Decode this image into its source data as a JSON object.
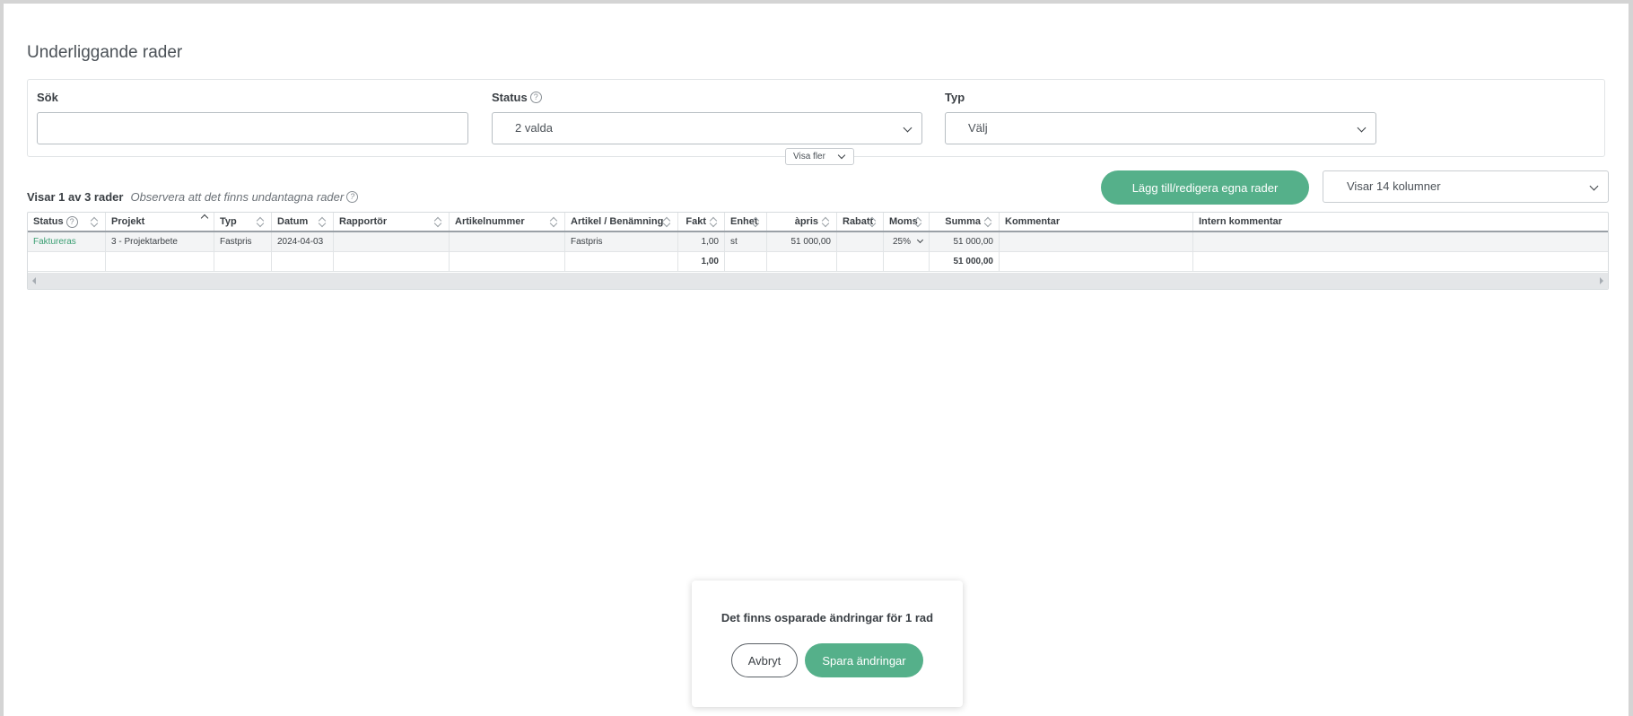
{
  "section": {
    "title": "Underliggande rader"
  },
  "filters": {
    "search": {
      "label": "Sök",
      "value": "",
      "placeholder": ""
    },
    "status": {
      "label": "Status",
      "value": "2 valda"
    },
    "type": {
      "label": "Typ",
      "value": "Välj"
    },
    "show_more": "Visa fler"
  },
  "summary": {
    "count": "Visar 1 av 3 rader",
    "note": "Observera att det finns undantagna rader"
  },
  "actions": {
    "edit_rows": "Lägg till/redigera egna rader",
    "columns": "Visar 14 kolumner"
  },
  "table": {
    "headers": [
      "Status",
      "Projekt",
      "Typ",
      "Datum",
      "Rapportör",
      "Artikelnummer",
      "Artikel / Benämning",
      "Fakt",
      "Enhet",
      "àpris",
      "Rabatt",
      "Moms",
      "Summa",
      "Kommentar",
      "Intern kommentar"
    ],
    "rows": [
      {
        "status": "Faktureras",
        "projekt": "3 - Projektarbete",
        "typ": "Fastpris",
        "datum": "2024-04-03",
        "rapportor": "",
        "artikelnummer": "",
        "artikel": "Fastpris",
        "fakt": "1,00",
        "enhet": "st",
        "apris": "51 000,00",
        "rabatt": "",
        "moms": "25%",
        "summa": "51 000,00",
        "kommentar": "",
        "intern": ""
      }
    ],
    "totals": {
      "fakt": "1,00",
      "summa": "51 000,00"
    }
  },
  "toast": {
    "message": "Det finns osparade ändringar för 1 rad",
    "cancel": "Avbryt",
    "save": "Spara ändringar"
  },
  "colors": {
    "accent": "#55b08a",
    "status_link": "#3a9e72"
  }
}
